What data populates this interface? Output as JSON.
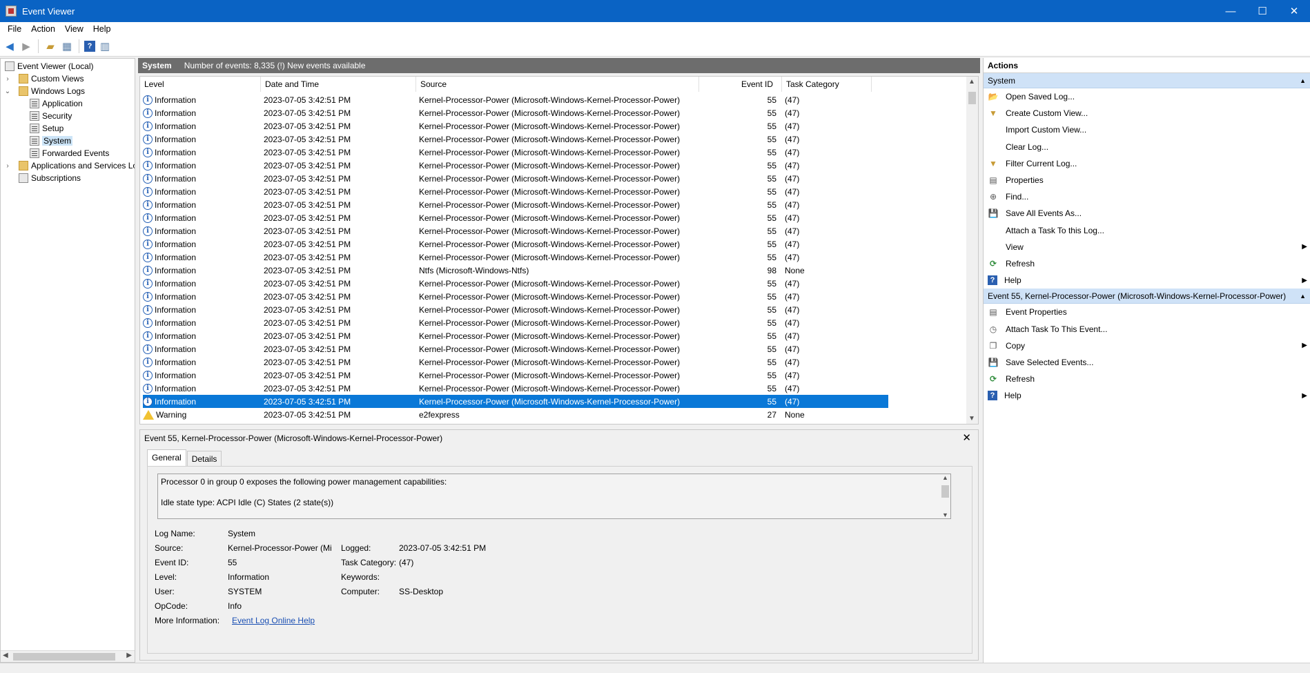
{
  "window": {
    "title": "Event Viewer",
    "minimize": "—",
    "maximize": "☐",
    "close": "✕"
  },
  "menu": [
    "File",
    "Action",
    "View",
    "Help"
  ],
  "tree": {
    "items": [
      {
        "label": "Event Viewer (Local)",
        "indent": 0,
        "expander": "",
        "selected": false
      },
      {
        "label": "Custom Views",
        "indent": 1,
        "expander": "›",
        "selected": false
      },
      {
        "label": "Windows Logs",
        "indent": 1,
        "expander": "⌄",
        "selected": false
      },
      {
        "label": "Application",
        "indent": 2,
        "expander": "",
        "selected": false
      },
      {
        "label": "Security",
        "indent": 2,
        "expander": "",
        "selected": false
      },
      {
        "label": "Setup",
        "indent": 2,
        "expander": "",
        "selected": false
      },
      {
        "label": "System",
        "indent": 2,
        "expander": "",
        "selected": true
      },
      {
        "label": "Forwarded Events",
        "indent": 2,
        "expander": "",
        "selected": false
      },
      {
        "label": "Applications and Services Lo",
        "indent": 1,
        "expander": "›",
        "selected": false
      },
      {
        "label": "Subscriptions",
        "indent": 1,
        "expander": "",
        "selected": false
      }
    ]
  },
  "center": {
    "log_name": "System",
    "event_count": "Number of events: 8,335 (!) New events available"
  },
  "columns": [
    "Level",
    "Date and Time",
    "Source",
    "Event ID",
    "Task Category"
  ],
  "events": [
    {
      "level": "Information",
      "date": "2023-07-05 3:42:51 PM",
      "source": "Kernel-Processor-Power (Microsoft-Windows-Kernel-Processor-Power)",
      "id": "55",
      "category": "(47)",
      "type": "info",
      "selected": false
    },
    {
      "level": "Information",
      "date": "2023-07-05 3:42:51 PM",
      "source": "Kernel-Processor-Power (Microsoft-Windows-Kernel-Processor-Power)",
      "id": "55",
      "category": "(47)",
      "type": "info",
      "selected": false
    },
    {
      "level": "Information",
      "date": "2023-07-05 3:42:51 PM",
      "source": "Kernel-Processor-Power (Microsoft-Windows-Kernel-Processor-Power)",
      "id": "55",
      "category": "(47)",
      "type": "info",
      "selected": false
    },
    {
      "level": "Information",
      "date": "2023-07-05 3:42:51 PM",
      "source": "Kernel-Processor-Power (Microsoft-Windows-Kernel-Processor-Power)",
      "id": "55",
      "category": "(47)",
      "type": "info",
      "selected": false
    },
    {
      "level": "Information",
      "date": "2023-07-05 3:42:51 PM",
      "source": "Kernel-Processor-Power (Microsoft-Windows-Kernel-Processor-Power)",
      "id": "55",
      "category": "(47)",
      "type": "info",
      "selected": false
    },
    {
      "level": "Information",
      "date": "2023-07-05 3:42:51 PM",
      "source": "Kernel-Processor-Power (Microsoft-Windows-Kernel-Processor-Power)",
      "id": "55",
      "category": "(47)",
      "type": "info",
      "selected": false
    },
    {
      "level": "Information",
      "date": "2023-07-05 3:42:51 PM",
      "source": "Kernel-Processor-Power (Microsoft-Windows-Kernel-Processor-Power)",
      "id": "55",
      "category": "(47)",
      "type": "info",
      "selected": false
    },
    {
      "level": "Information",
      "date": "2023-07-05 3:42:51 PM",
      "source": "Kernel-Processor-Power (Microsoft-Windows-Kernel-Processor-Power)",
      "id": "55",
      "category": "(47)",
      "type": "info",
      "selected": false
    },
    {
      "level": "Information",
      "date": "2023-07-05 3:42:51 PM",
      "source": "Kernel-Processor-Power (Microsoft-Windows-Kernel-Processor-Power)",
      "id": "55",
      "category": "(47)",
      "type": "info",
      "selected": false
    },
    {
      "level": "Information",
      "date": "2023-07-05 3:42:51 PM",
      "source": "Kernel-Processor-Power (Microsoft-Windows-Kernel-Processor-Power)",
      "id": "55",
      "category": "(47)",
      "type": "info",
      "selected": false
    },
    {
      "level": "Information",
      "date": "2023-07-05 3:42:51 PM",
      "source": "Kernel-Processor-Power (Microsoft-Windows-Kernel-Processor-Power)",
      "id": "55",
      "category": "(47)",
      "type": "info",
      "selected": false
    },
    {
      "level": "Information",
      "date": "2023-07-05 3:42:51 PM",
      "source": "Kernel-Processor-Power (Microsoft-Windows-Kernel-Processor-Power)",
      "id": "55",
      "category": "(47)",
      "type": "info",
      "selected": false
    },
    {
      "level": "Information",
      "date": "2023-07-05 3:42:51 PM",
      "source": "Kernel-Processor-Power (Microsoft-Windows-Kernel-Processor-Power)",
      "id": "55",
      "category": "(47)",
      "type": "info",
      "selected": false
    },
    {
      "level": "Information",
      "date": "2023-07-05 3:42:51 PM",
      "source": "Ntfs (Microsoft-Windows-Ntfs)",
      "id": "98",
      "category": "None",
      "type": "info",
      "selected": false
    },
    {
      "level": "Information",
      "date": "2023-07-05 3:42:51 PM",
      "source": "Kernel-Processor-Power (Microsoft-Windows-Kernel-Processor-Power)",
      "id": "55",
      "category": "(47)",
      "type": "info",
      "selected": false
    },
    {
      "level": "Information",
      "date": "2023-07-05 3:42:51 PM",
      "source": "Kernel-Processor-Power (Microsoft-Windows-Kernel-Processor-Power)",
      "id": "55",
      "category": "(47)",
      "type": "info",
      "selected": false
    },
    {
      "level": "Information",
      "date": "2023-07-05 3:42:51 PM",
      "source": "Kernel-Processor-Power (Microsoft-Windows-Kernel-Processor-Power)",
      "id": "55",
      "category": "(47)",
      "type": "info",
      "selected": false
    },
    {
      "level": "Information",
      "date": "2023-07-05 3:42:51 PM",
      "source": "Kernel-Processor-Power (Microsoft-Windows-Kernel-Processor-Power)",
      "id": "55",
      "category": "(47)",
      "type": "info",
      "selected": false
    },
    {
      "level": "Information",
      "date": "2023-07-05 3:42:51 PM",
      "source": "Kernel-Processor-Power (Microsoft-Windows-Kernel-Processor-Power)",
      "id": "55",
      "category": "(47)",
      "type": "info",
      "selected": false
    },
    {
      "level": "Information",
      "date": "2023-07-05 3:42:51 PM",
      "source": "Kernel-Processor-Power (Microsoft-Windows-Kernel-Processor-Power)",
      "id": "55",
      "category": "(47)",
      "type": "info",
      "selected": false
    },
    {
      "level": "Information",
      "date": "2023-07-05 3:42:51 PM",
      "source": "Kernel-Processor-Power (Microsoft-Windows-Kernel-Processor-Power)",
      "id": "55",
      "category": "(47)",
      "type": "info",
      "selected": false
    },
    {
      "level": "Information",
      "date": "2023-07-05 3:42:51 PM",
      "source": "Kernel-Processor-Power (Microsoft-Windows-Kernel-Processor-Power)",
      "id": "55",
      "category": "(47)",
      "type": "info",
      "selected": false
    },
    {
      "level": "Information",
      "date": "2023-07-05 3:42:51 PM",
      "source": "Kernel-Processor-Power (Microsoft-Windows-Kernel-Processor-Power)",
      "id": "55",
      "category": "(47)",
      "type": "info",
      "selected": false
    },
    {
      "level": "Information",
      "date": "2023-07-05 3:42:51 PM",
      "source": "Kernel-Processor-Power (Microsoft-Windows-Kernel-Processor-Power)",
      "id": "55",
      "category": "(47)",
      "type": "info",
      "selected": true
    },
    {
      "level": "Warning",
      "date": "2023-07-05 3:42:51 PM",
      "source": "e2fexpress",
      "id": "27",
      "category": "None",
      "type": "warning",
      "selected": false
    }
  ],
  "detail": {
    "title": "Event 55, Kernel-Processor-Power (Microsoft-Windows-Kernel-Processor-Power)",
    "close": "✕",
    "tabs": [
      "General",
      "Details"
    ],
    "description": [
      "Processor 0 in group 0 exposes the following power management capabilities:",
      "Idle state type: ACPI Idle (C) States (2 state(s))"
    ],
    "fields": {
      "log_name_label": "Log Name:",
      "log_name": "System",
      "source_label": "Source:",
      "source": "Kernel-Processor-Power (Mi",
      "logged_label": "Logged:",
      "logged": "2023-07-05 3:42:51 PM",
      "event_id_label": "Event ID:",
      "event_id": "55",
      "task_category_label": "Task Category:",
      "task_category": "(47)",
      "level_label": "Level:",
      "level": "Information",
      "keywords_label": "Keywords:",
      "keywords": "",
      "user_label": "User:",
      "user": "SYSTEM",
      "computer_label": "Computer:",
      "computer": "SS-Desktop",
      "opcode_label": "OpCode:",
      "opcode": "Info",
      "more_info_label": "More Information:",
      "more_info_link": "Event Log Online Help"
    }
  },
  "actions": {
    "title": "Actions",
    "sections": [
      {
        "header": "System",
        "items": [
          {
            "label": "Open Saved Log...",
            "icon": "folder-open-icon",
            "glyph": "📂",
            "submenu": false
          },
          {
            "label": "Create Custom View...",
            "icon": "filter-create-icon",
            "glyph": "▼",
            "submenu": false
          },
          {
            "label": "Import Custom View...",
            "icon": "",
            "glyph": "",
            "submenu": false
          },
          {
            "label": "Clear Log...",
            "icon": "",
            "glyph": "",
            "submenu": false
          },
          {
            "label": "Filter Current Log...",
            "icon": "filter-icon",
            "glyph": "▼",
            "submenu": false
          },
          {
            "label": "Properties",
            "icon": "properties-icon",
            "glyph": "▤",
            "submenu": false
          },
          {
            "label": "Find...",
            "icon": "binoculars-icon",
            "glyph": "⊕",
            "submenu": false
          },
          {
            "label": "Save All Events As...",
            "icon": "save-icon",
            "glyph": "💾",
            "submenu": false
          },
          {
            "label": "Attach a Task To this Log...",
            "icon": "",
            "glyph": "",
            "submenu": false
          },
          {
            "label": "View",
            "icon": "",
            "glyph": "",
            "submenu": true
          },
          {
            "label": "Refresh",
            "icon": "refresh-icon",
            "glyph": "⟳",
            "submenu": false
          },
          {
            "label": "Help",
            "icon": "help-icon",
            "glyph": "?",
            "submenu": true
          }
        ]
      },
      {
        "header": "Event 55, Kernel-Processor-Power (Microsoft-Windows-Kernel-Processor-Power)",
        "items": [
          {
            "label": "Event Properties",
            "icon": "event-properties-icon",
            "glyph": "▤",
            "submenu": false
          },
          {
            "label": "Attach Task To This Event...",
            "icon": "task-icon",
            "glyph": "◷",
            "submenu": false
          },
          {
            "label": "Copy",
            "icon": "copy-icon",
            "glyph": "❐",
            "submenu": true
          },
          {
            "label": "Save Selected Events...",
            "icon": "save-icon",
            "glyph": "💾",
            "submenu": false
          },
          {
            "label": "Refresh",
            "icon": "refresh-icon",
            "glyph": "⟳",
            "submenu": false
          },
          {
            "label": "Help",
            "icon": "help-icon",
            "glyph": "?",
            "submenu": true
          }
        ]
      }
    ]
  },
  "colors": {
    "titlebar": "#0a63c4",
    "selection": "#0a78d7",
    "section_header": "#cfe2f7",
    "center_header": "#6d6d6d",
    "link": "#1a4fb3"
  }
}
